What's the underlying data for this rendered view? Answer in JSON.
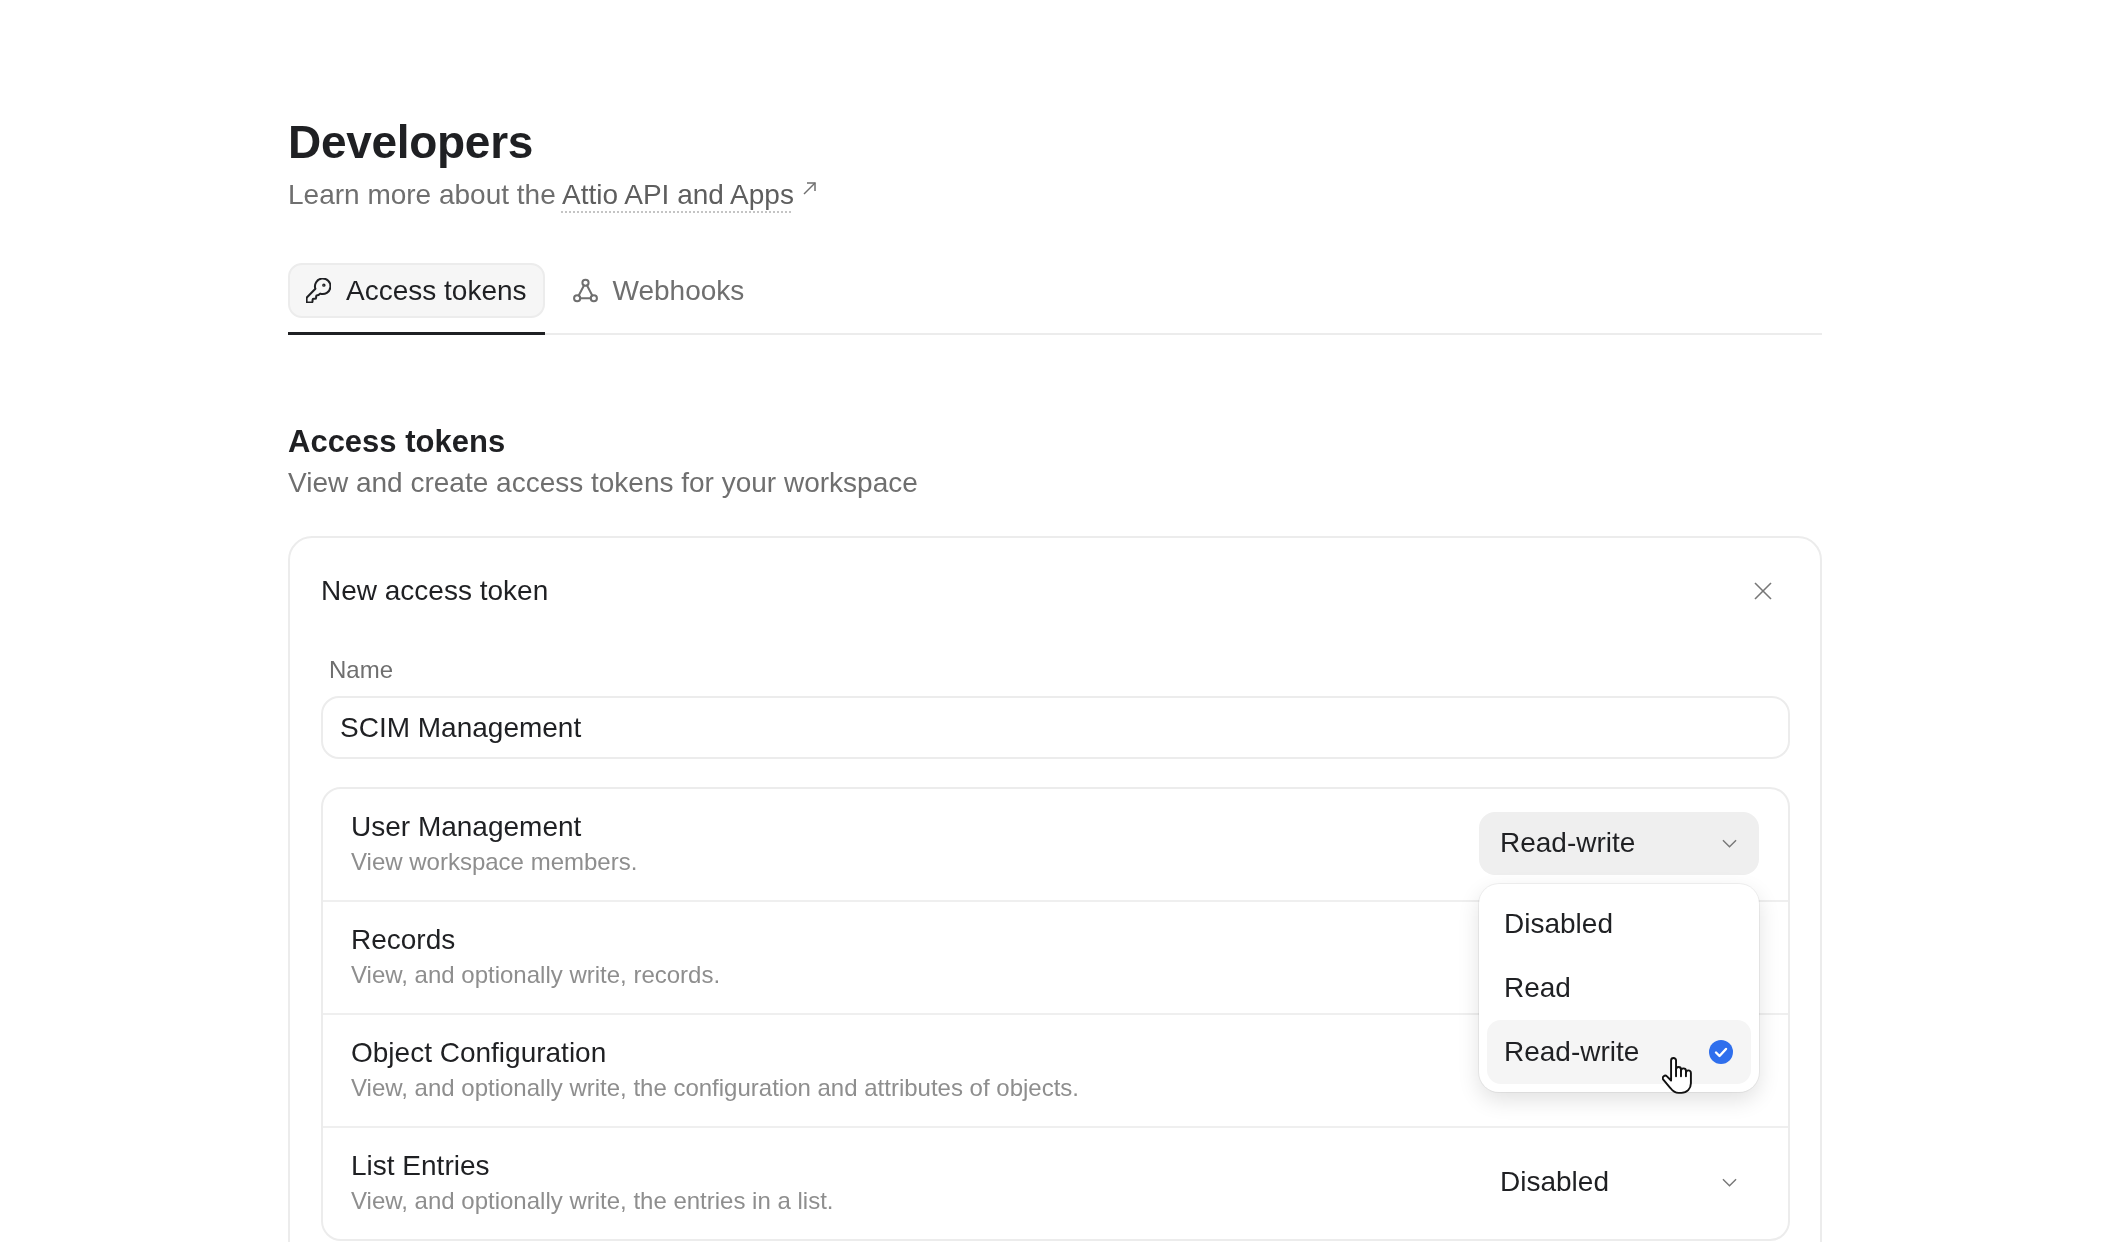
{
  "page": {
    "title": "Developers",
    "subtitle": "Learn more about the",
    "link": "Attio API and Apps"
  },
  "tabs": [
    {
      "label": "Access tokens",
      "selected": true
    },
    {
      "label": "Webhooks",
      "selected": false
    }
  ],
  "section": {
    "title": "Access tokens",
    "subtitle": "View and create access tokens for your workspace"
  },
  "token_form": {
    "title": "New access token",
    "name_field": {
      "label": "Name",
      "value": "SCIM Management"
    },
    "scopes": [
      {
        "name": "User Management",
        "description": "View workspace members.",
        "value": "Read-write",
        "open": true,
        "options": [
          {
            "label": "Disabled",
            "selected": false,
            "hovered": false
          },
          {
            "label": "Read",
            "selected": false,
            "hovered": false
          },
          {
            "label": "Read-write",
            "selected": true,
            "hovered": true
          }
        ]
      },
      {
        "name": "Records",
        "description": "View, and optionally write, records."
      },
      {
        "name": "Object Configuration",
        "description": "View, and optionally write, the configuration and attributes of objects."
      },
      {
        "name": "List Entries",
        "description": "View, and optionally write, the entries in a list.",
        "value": "Disabled",
        "open": false
      }
    ]
  }
}
